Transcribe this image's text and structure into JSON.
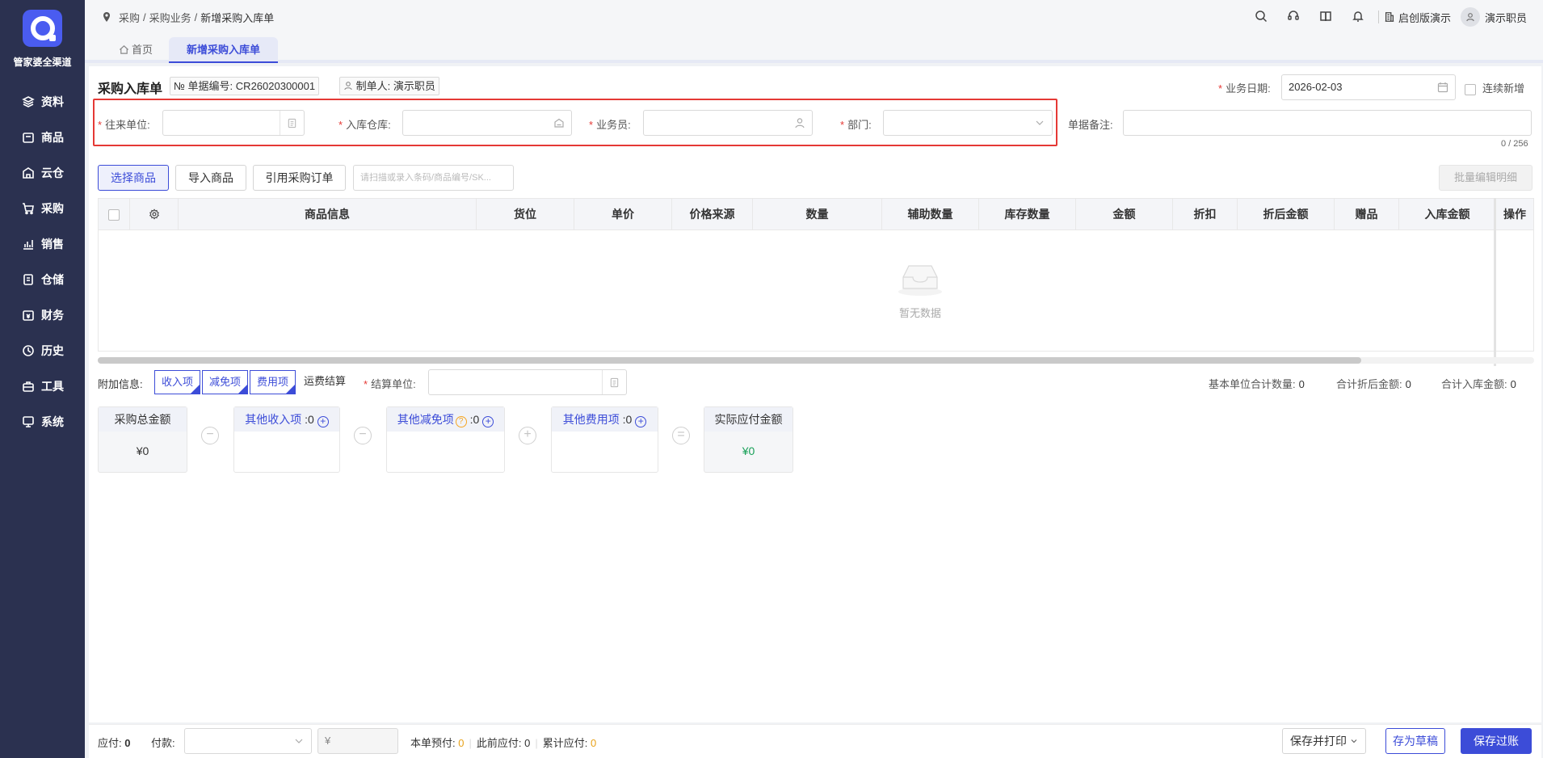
{
  "app": {
    "brand": "管家婆全渠道",
    "colors": {
      "sidebar": "#2b3150",
      "accent": "#3c4cd8",
      "required": "#e53935",
      "highlight_box": "#e53935",
      "amount_green": "#18a058",
      "amount_orange": "#e8a21a"
    }
  },
  "sidebar": {
    "items": [
      {
        "label": "资料",
        "icon": "layers-icon"
      },
      {
        "label": "商品",
        "icon": "box-icon"
      },
      {
        "label": "云仓",
        "icon": "cloud-warehouse-icon"
      },
      {
        "label": "采购",
        "icon": "cart-icon"
      },
      {
        "label": "销售",
        "icon": "chart-icon"
      },
      {
        "label": "仓储",
        "icon": "storage-icon"
      },
      {
        "label": "财务",
        "icon": "finance-icon"
      },
      {
        "label": "历史",
        "icon": "history-icon"
      },
      {
        "label": "工具",
        "icon": "toolbox-icon"
      },
      {
        "label": "系统",
        "icon": "monitor-icon"
      }
    ]
  },
  "header": {
    "breadcrumb": [
      "采购",
      "采购业务",
      "新增采购入库单"
    ],
    "breadcrumb_sep": "/",
    "company": "启创版演示",
    "user": "演示职员"
  },
  "tabs": [
    {
      "label": "首页"
    },
    {
      "label": "新增采购入库单",
      "active": true
    }
  ],
  "form": {
    "title": "采购入库单",
    "doc_no_label": "№ 单据编号:",
    "doc_no": "CR26020300001",
    "maker_label": "制单人:",
    "maker": "演示职员",
    "biz_date_label": "业务日期:",
    "biz_date": "2026-02-03",
    "continue_add_label": "连续新增",
    "partner_label": "往来单位:",
    "partner_value": "",
    "warehouse_label": "入库仓库:",
    "warehouse_value": "",
    "salesman_label": "业务员:",
    "salesman_value": "",
    "dept_label": "部门:",
    "dept_value": "",
    "remark_label": "单据备注:",
    "remark_value": "",
    "remark_counter": "0 / 256"
  },
  "toolbar": {
    "select_goods": "选择商品",
    "import_goods": "导入商品",
    "quote_order": "引用采购订单",
    "scan_placeholder": "请扫描或录入条码/商品编号/SK...",
    "batch_edit": "批量编辑明细"
  },
  "table": {
    "columns": [
      "商品信息",
      "货位",
      "单价",
      "价格来源",
      "数量",
      "辅助数量",
      "库存数量",
      "金额",
      "折扣",
      "折后金额",
      "赠品",
      "入库金额",
      "操作"
    ],
    "rows": [],
    "empty_text": "暂无数据"
  },
  "extra": {
    "label": "附加信息:",
    "chips": [
      "收入项",
      "减免项",
      "费用项"
    ],
    "freight": "运费结算",
    "settle_label": "结算单位:",
    "settle_value": "",
    "base_qty_label": "基本单位合计数量:",
    "base_qty": "0",
    "disc_total_label": "合计折后金额:",
    "disc_total": "0",
    "in_total_label": "合计入库金额:",
    "in_total": "0"
  },
  "cards": {
    "purchase_total_label": "采购总金额",
    "purchase_total": "¥0",
    "other_income_label": "其他收入项",
    "other_income": ":0",
    "other_reduce_label": "其他减免项",
    "other_reduce": ":0",
    "other_fee_label": "其他费用项",
    "other_fee": ":0",
    "actual_label": "实际应付金额",
    "actual": "¥0",
    "ops": [
      "−",
      "−",
      "+",
      "="
    ]
  },
  "footer": {
    "payable_label": "应付:",
    "payable": "0",
    "payment_label": "付款:",
    "payment_value": "",
    "currency": "¥",
    "prepay_label": "本单预付:",
    "prepay": "0",
    "before_label": "此前应付:",
    "before": "0",
    "accum_label": "累计应付:",
    "accum": "0",
    "save_print": "保存并打印",
    "save_draft": "存为草稿",
    "save_post": "保存过账"
  }
}
